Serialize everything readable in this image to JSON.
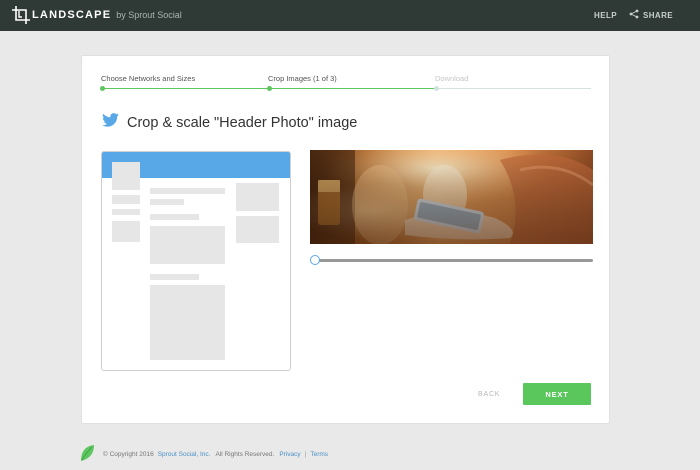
{
  "header": {
    "logo_word": "LANDSCAPE",
    "logo_by": "by Sprout Social",
    "help_label": "HELP",
    "share_label": "SHARE"
  },
  "steps": [
    {
      "label": "Choose Networks and Sizes",
      "state": "complete"
    },
    {
      "label": "Crop Images (1 of 3)",
      "state": "complete"
    },
    {
      "label": "Download",
      "state": "upcoming"
    }
  ],
  "main": {
    "title": "Crop & scale \"Header Photo\" image",
    "network_icon": "twitter-bird-icon",
    "zoom_slider_value": 0
  },
  "buttons": {
    "back_label": "BACK",
    "next_label": "NEXT"
  },
  "footer": {
    "copyright_prefix": "© Copyright 2016",
    "company_link": "Sprout Social, Inc.",
    "rights": "All Rights Reserved.",
    "privacy_link": "Privacy",
    "divider": "|",
    "terms_link": "Terms"
  },
  "colors": {
    "topbar": "#2f3a37",
    "accent_green": "#59c75c",
    "twitter_blue": "#58a8e8",
    "link_blue": "#4a90c7"
  }
}
